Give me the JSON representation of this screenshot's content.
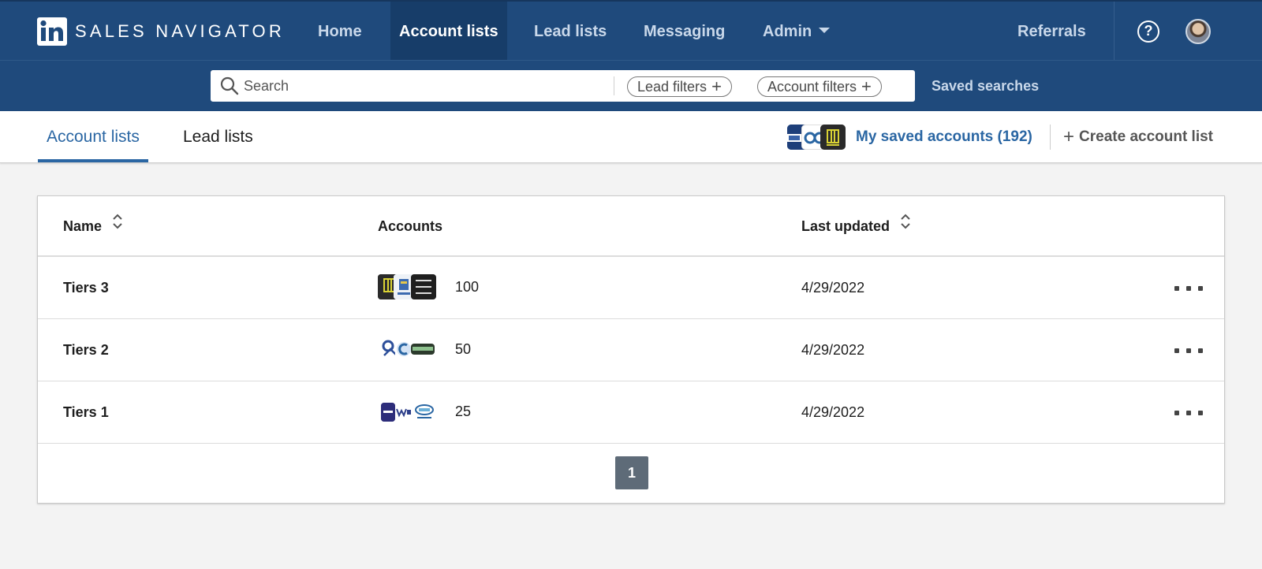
{
  "brand": {
    "name": "SALES NAVIGATOR"
  },
  "nav": {
    "items": [
      {
        "label": "Home",
        "active": false
      },
      {
        "label": "Account lists",
        "active": true
      },
      {
        "label": "Lead lists",
        "active": false
      },
      {
        "label": "Messaging",
        "active": false
      },
      {
        "label": "Admin",
        "active": false
      }
    ],
    "referrals": "Referrals",
    "help_symbol": "?"
  },
  "search": {
    "placeholder": "Search",
    "lead_filters": "Lead filters",
    "account_filters": "Account filters",
    "saved_searches": "Saved searches"
  },
  "subnav": {
    "tabs": [
      {
        "label": "Account lists",
        "active": true
      },
      {
        "label": "Lead lists",
        "active": false
      }
    ],
    "saved_accounts": "My saved accounts (192)",
    "create_list": "Create account list"
  },
  "table": {
    "headers": {
      "name": "Name",
      "accounts": "Accounts",
      "last_updated": "Last updated"
    },
    "rows": [
      {
        "name": "Tiers 3",
        "accounts": "100",
        "last_updated": "4/29/2022"
      },
      {
        "name": "Tiers 2",
        "accounts": "50",
        "last_updated": "4/29/2022"
      },
      {
        "name": "Tiers 1",
        "accounts": "25",
        "last_updated": "4/29/2022"
      }
    ]
  },
  "pagination": {
    "current_page": "1"
  },
  "colors": {
    "navbar": "#1f4a7c",
    "navbar_active": "#173d69",
    "accent_link": "#2a66a3",
    "page_bg": "#f3f3f3",
    "pager_bg": "#5e6b78"
  }
}
